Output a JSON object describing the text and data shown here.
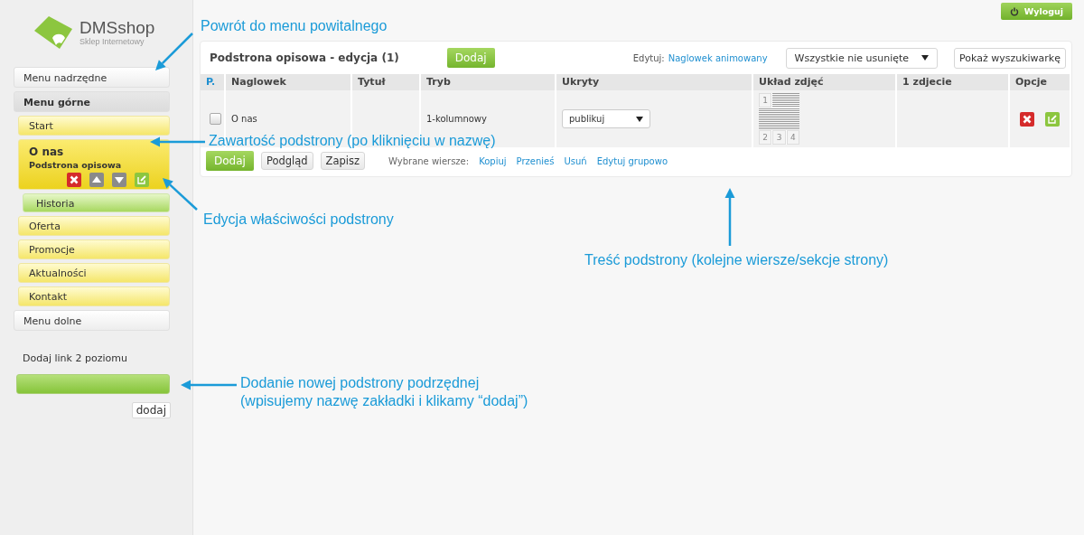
{
  "header": {
    "logout": "Wyloguj"
  },
  "sidebar": {
    "logo": {
      "name": "DMSshop",
      "tagline": "Sklep Internetowy"
    },
    "items": [
      {
        "kind": "section",
        "label": "Menu nadrzędne",
        "selected": false
      },
      {
        "kind": "header",
        "label": "Menu górne",
        "selected": false
      },
      {
        "kind": "page",
        "label": "Start",
        "selected": false
      },
      {
        "kind": "page",
        "label": "O nas",
        "subtitle": "Podstrona opisowa",
        "selected": true
      },
      {
        "kind": "subpage",
        "label": "Historia",
        "selected": false
      },
      {
        "kind": "page",
        "label": "Oferta",
        "selected": false
      },
      {
        "kind": "page",
        "label": "Promocje",
        "selected": false
      },
      {
        "kind": "page",
        "label": "Aktualności",
        "selected": false
      },
      {
        "kind": "page",
        "label": "Kontakt",
        "selected": false
      },
      {
        "kind": "section",
        "label": "Menu dolne",
        "selected": false
      }
    ],
    "add_link": {
      "label": "Dodaj link 2 poziomu",
      "button": "dodaj"
    }
  },
  "panel": {
    "title": "Podstrona opisowa - edycja (1)",
    "add_button": "Dodaj",
    "edit_label": "Edytuj:",
    "edit_link": "Naglowek animowany",
    "filter": "Wszystkie nie usunięte",
    "search_button": "Pokaż wyszukiwarkę",
    "table": {
      "columns": [
        "P.",
        "Naglowek",
        "Tytuł",
        "Tryb",
        "Ukryty",
        "Układ zdjęć",
        "1 zdjecie",
        "Opcje"
      ],
      "rows": [
        {
          "checked": false,
          "naglowek": "O nas",
          "tryb": "1-kolumnowy",
          "ukryty": "publikuj",
          "layout_cells": [
            "1",
            "2",
            "3",
            "4"
          ]
        }
      ]
    },
    "footer": {
      "buttons": [
        {
          "label": "Dodaj",
          "kind": "primary"
        },
        {
          "label": "Podgląd",
          "kind": "default"
        },
        {
          "label": "Zapisz",
          "kind": "default"
        }
      ],
      "selected_label": "Wybrane wiersze:",
      "actions": [
        "Kopiuj",
        "Przenieś",
        "Usuń",
        "Edytuj grupowo"
      ]
    }
  },
  "annotations": [
    {
      "lines": [
        "Powrót do menu powitalnego"
      ]
    },
    {
      "lines": [
        "Zawartość podstrony (po kliknięciu w nazwę)"
      ]
    },
    {
      "lines": [
        "Edycja właściwości podstrony"
      ]
    },
    {
      "lines": [
        "Treść podstrony (kolejne wiersze/sekcje strony)"
      ]
    },
    {
      "lines": [
        "Dodanie nowej podstrony podrzędnej",
        "(wpisujemy nazwę zakładki i klikamy “dodaj”)"
      ]
    }
  ]
}
